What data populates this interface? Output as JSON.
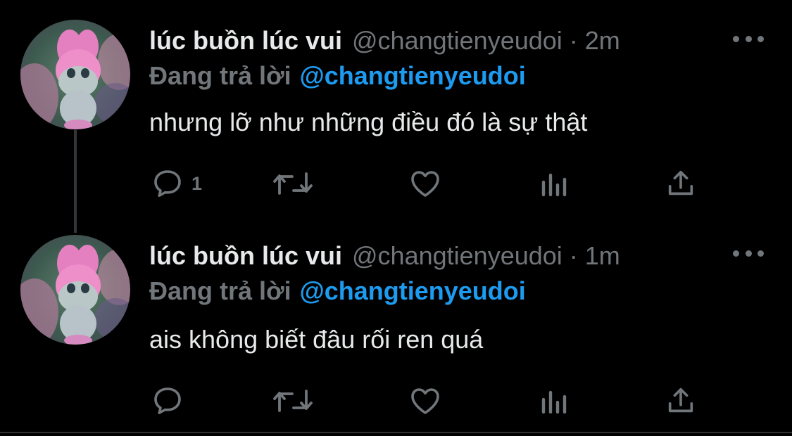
{
  "tweets": [
    {
      "author_name": "lúc buồn lúc vui",
      "handle": "@changtienyeudoi",
      "separator": "·",
      "time": "2m",
      "replying_label": "Đang trả lời",
      "replying_to": "@changtienyeudoi",
      "text": "nhưng lỡ như những điều đó là sự thật",
      "reply_count": "1",
      "avatar_desc": "pink-bunny-avatar",
      "more_icon": "ellipsis-icon"
    },
    {
      "author_name": "lúc buồn lúc vui",
      "handle": "@changtienyeudoi",
      "separator": "·",
      "time": "1m",
      "replying_label": "Đang trả lời",
      "replying_to": "@changtienyeudoi",
      "text": "ais không biết đâu rối ren quá",
      "reply_count": "",
      "avatar_desc": "pink-bunny-avatar",
      "more_icon": "ellipsis-icon"
    }
  ],
  "icons": [
    "reply-icon",
    "retweet-icon",
    "like-icon",
    "views-icon",
    "share-icon"
  ],
  "colors": {
    "background": "#000000",
    "primary_text": "#e7e9ea",
    "secondary_text": "#71767b",
    "accent": "#1d9bf0",
    "thread_line": "#333639"
  }
}
